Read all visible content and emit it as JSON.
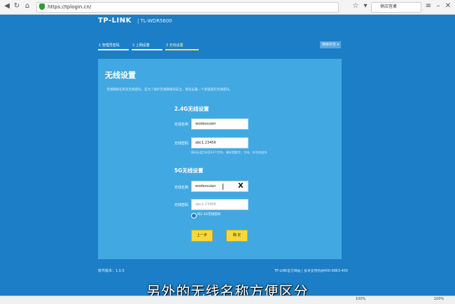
{
  "browser": {
    "url": "https://tplogin.cn/",
    "search_text": "供应宫桌"
  },
  "header": {
    "logo": "TP-LINK",
    "model": "| TL-WDR5600",
    "steps": [
      "1 管理员密码",
      "2 上网设置",
      "3 无线设置"
    ],
    "lang_button": "简体中文 ▾"
  },
  "card": {
    "title": "无线设置",
    "intro": "无线网络名称及无线密码，是为了保护无线网络的安全，建议设置一个高强度的无线密码。",
    "band24": {
      "heading": "2.4G无线设置",
      "ssid_label": "无线名称",
      "ssid_value": "wodessuian",
      "pwd_label": "无线密码",
      "pwd_value": "abc1.23456",
      "hint": "密码长度为8至63个字符，最好是数字、字母、符号的组合"
    },
    "band5": {
      "heading": "5G无线设置",
      "ssid_label": "无线名称",
      "ssid_value": "wodessuian",
      "clear_mark": "X",
      "pwd_label": "无线密码",
      "pwd_value": "abc1.23456",
      "checkbox_label": "同2.4G无线密码"
    },
    "prev_button": "上一步",
    "ok_button": "确 定"
  },
  "footer": {
    "version": "软件版本：1.0.5",
    "right": "TP-LINK官方网站  |  技术支持热线400-8863-400"
  },
  "subtitle": "另外的无线名称方便区分",
  "statusbar": {
    "left": "100%",
    "right": "100%"
  }
}
